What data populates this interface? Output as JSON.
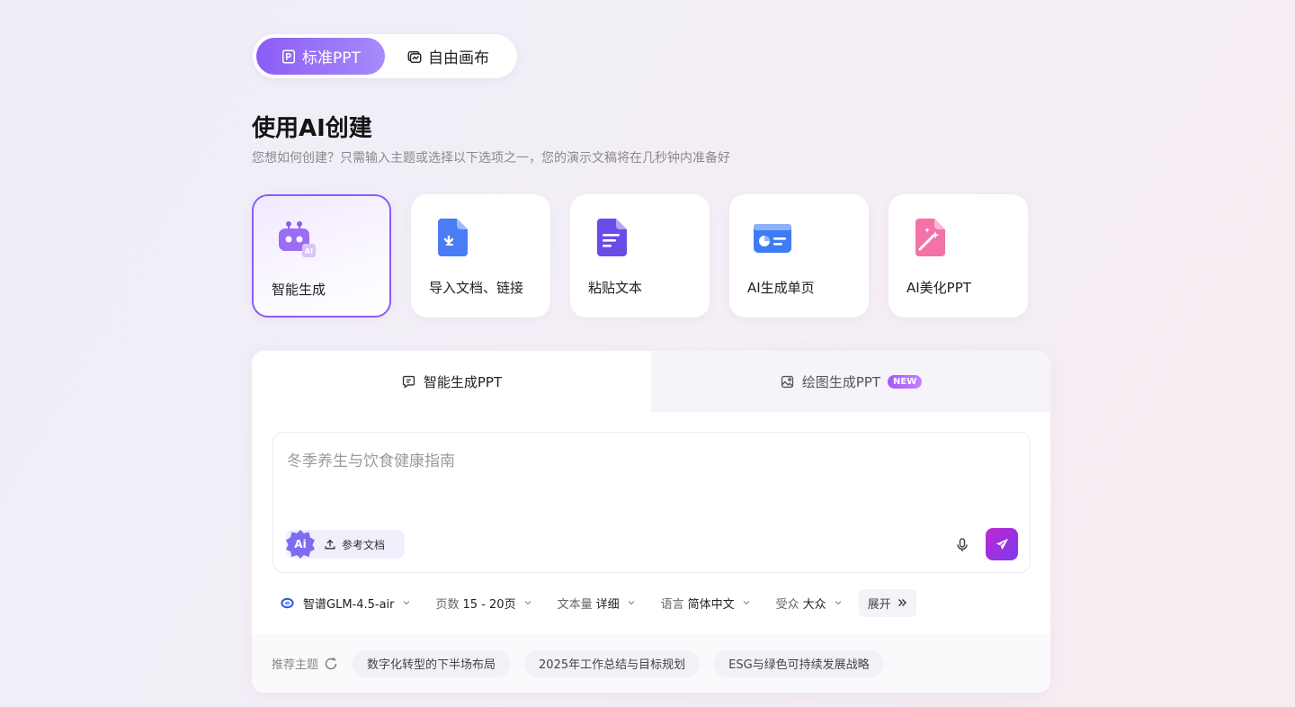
{
  "mode_switch": {
    "standard_label": "标准PPT",
    "free_label": "自由画布"
  },
  "header": {
    "title": "使用AI创建",
    "subtitle": "您想如何创建？只需输入主题或选择以下选项之一，您的演示文稿将在几秒钟内准备好"
  },
  "cards": [
    {
      "label": "智能生成",
      "icon": "robot-icon"
    },
    {
      "label": "导入文档、链接",
      "icon": "import-document-icon"
    },
    {
      "label": "粘贴文本",
      "icon": "text-document-icon"
    },
    {
      "label": "AI生成单页",
      "icon": "single-page-icon"
    },
    {
      "label": "AI美化PPT",
      "icon": "magic-wand-icon"
    }
  ],
  "tabs": {
    "smart_label": "智能生成PPT",
    "draw_label": "绘图生成PPT",
    "new_badge": "NEW"
  },
  "input": {
    "placeholder": "冬季养生与饮食健康指南",
    "ai_badge": "Ai",
    "reference_label": "参考文档"
  },
  "options": {
    "model_value": "智谱GLM-4.5-air",
    "pages_label": "页数",
    "pages_value": "15 - 20页",
    "text_label": "文本量",
    "text_value": "详细",
    "lang_label": "语言",
    "lang_value": "简体中文",
    "audience_label": "受众",
    "audience_value": "大众",
    "expand_label": "展开"
  },
  "recommend": {
    "label": "推荐主题",
    "topics": [
      "数字化转型的下半场布局",
      "2025年工作总结与目标规划",
      "ESG与绿色可持续发展战略"
    ]
  },
  "colors": {
    "accent": "#8b5cf6",
    "send_gradient_start": "#c026d3",
    "send_gradient_end": "#7c3aed"
  }
}
